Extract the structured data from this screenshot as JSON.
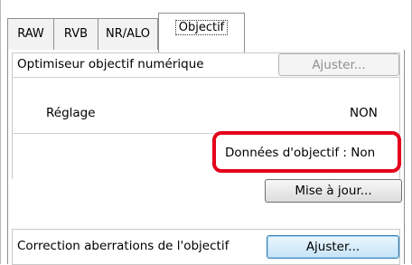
{
  "tabs": [
    {
      "label": "RAW"
    },
    {
      "label": "RVB"
    },
    {
      "label": "NR/ALO"
    },
    {
      "label": "Objectif",
      "active": true
    }
  ],
  "optimizer": {
    "title": "Optimiseur objectif numérique",
    "adjust_button": "Ajuster...",
    "setting_label": "Réglage",
    "setting_value": "NON"
  },
  "lens_data": {
    "status_text": "Données d'objectif : Non",
    "update_button": "Mise à jour..."
  },
  "aberration": {
    "label": "Correction aberrations de l'objectif",
    "adjust_button": "Ajuster..."
  },
  "colors": {
    "highlight": "#e4001b",
    "focused_button": "#3c7fb1"
  }
}
